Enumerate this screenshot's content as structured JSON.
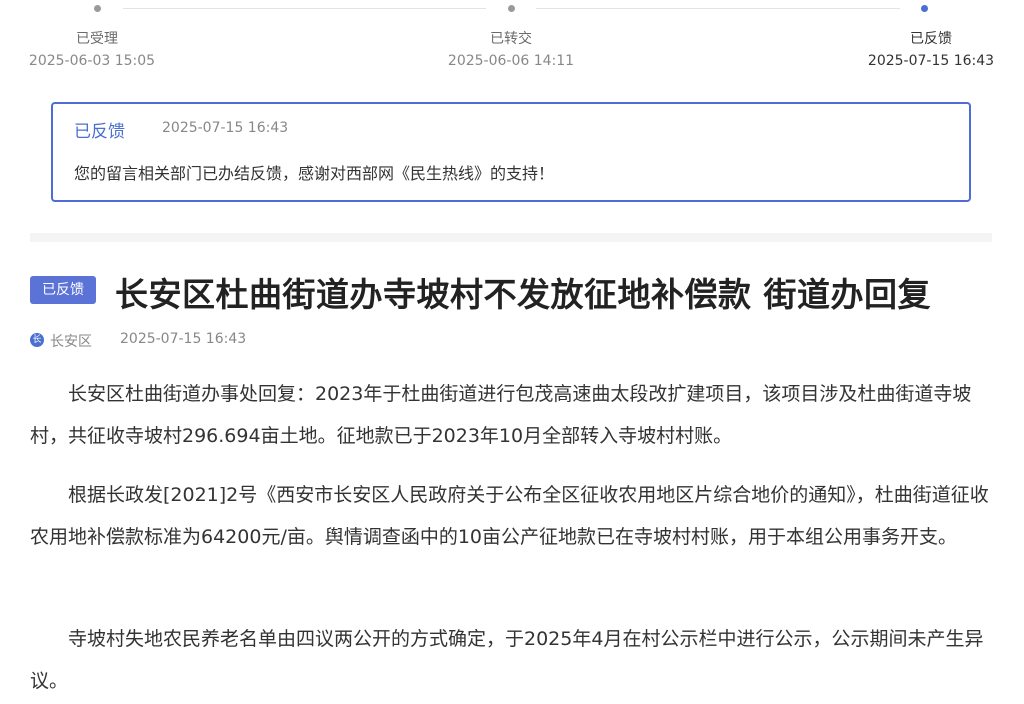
{
  "timeline": [
    {
      "label": "已受理",
      "time": "2025-06-03 15:05",
      "active": false
    },
    {
      "label": "已转交",
      "time": "2025-06-06 14:11",
      "active": false
    },
    {
      "label": "已反馈",
      "time": "2025-07-15 16:43",
      "active": true
    }
  ],
  "feedback": {
    "status": "已反馈",
    "time": "2025-07-15 16:43",
    "message": "您的留言相关部门已办结反馈，感谢对西部网《民生热线》的支持！"
  },
  "article": {
    "badge": "已反馈",
    "title": "长安区杜曲街道办寺坡村不发放征地补偿款 街道办回复",
    "source_icon_char": "长",
    "source": "长安区",
    "time": "2025-07-15 16:43",
    "paragraphs": [
      "长安区杜曲街道办事处回复：2023年于杜曲街道进行包茂高速曲太段改扩建项目，该项目涉及杜曲街道寺坡村，共征收寺坡村296.694亩土地。征地款已于2023年10月全部转入寺坡村村账。",
      "根据长政发[2021]2号《西安市长安区人民政府关于公布全区征收农用地区片综合地价的通知》，杜曲街道征收农用地补偿款标准为64200元/亩。舆情调查函中的10亩公产征地款已在寺坡村村账，用于本组公用事务开支。",
      "寺坡村失地农民养老名单由四议两公开的方式确定，于2025年4月在村公示栏中进行公示，公示期间未产生异议。"
    ]
  },
  "colors": {
    "accent": "#4a6fd0",
    "badge": "#5b72d6"
  }
}
